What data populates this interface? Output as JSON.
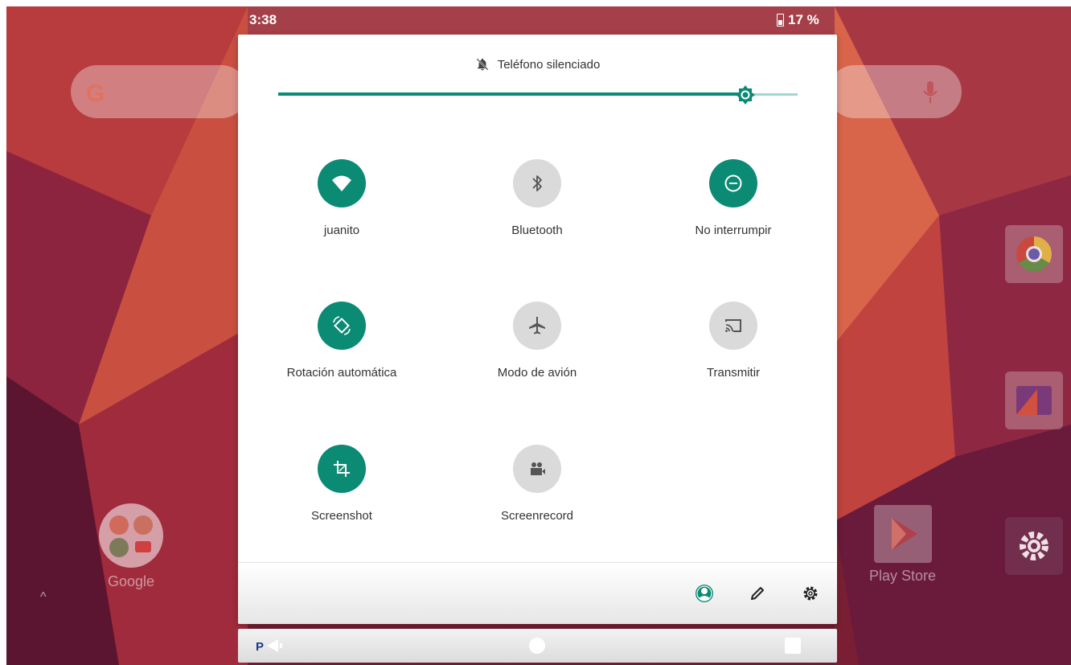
{
  "status_bar": {
    "time": "3:38",
    "battery": "17 %"
  },
  "home_screen": {
    "apps": [
      {
        "label": "Google"
      },
      {
        "label": "Play Store"
      }
    ]
  },
  "quick_settings": {
    "sound_status": "Teléfono silenciado",
    "brightness_level_percent": 90,
    "tiles": [
      {
        "label": "juanito",
        "icon": "wifi-icon",
        "active": true
      },
      {
        "label": "Bluetooth",
        "icon": "bluetooth-icon",
        "active": false
      },
      {
        "label": "No interrumpir",
        "icon": "do-not-disturb-icon",
        "active": true
      },
      {
        "label": "Rotación automática",
        "icon": "auto-rotate-icon",
        "active": true
      },
      {
        "label": "Modo de avión",
        "icon": "airplane-icon",
        "active": false
      },
      {
        "label": "Transmitir",
        "icon": "cast-icon",
        "active": false
      },
      {
        "label": "Screenshot",
        "icon": "crop-icon",
        "active": true
      },
      {
        "label": "Screenrecord",
        "icon": "video-camera-icon",
        "active": false
      }
    ],
    "footer": {
      "icons": [
        "user-icon",
        "pencil-icon",
        "gear-icon"
      ]
    }
  },
  "colors": {
    "accent": "#0b8a74",
    "tile_off": "#dadada",
    "brightness_track": "#9fd6cf"
  }
}
